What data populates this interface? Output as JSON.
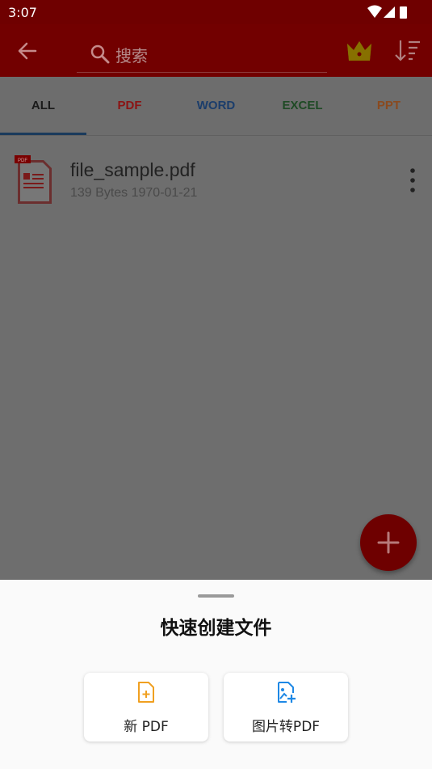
{
  "status_bar": {
    "time": "3:07"
  },
  "app_bar": {
    "search_placeholder": "搜索"
  },
  "tabs": [
    {
      "label": "ALL",
      "color": "#1a1a1a",
      "active": true
    },
    {
      "label": "PDF",
      "color": "#8b1414"
    },
    {
      "label": "WORD",
      "color": "#1b3d6b"
    },
    {
      "label": "EXCEL",
      "color": "#1f4a25"
    },
    {
      "label": "PPT",
      "color": "#8a4a1f"
    }
  ],
  "files": [
    {
      "name": "file_sample.pdf",
      "meta": "139 Bytes 1970-01-21",
      "icon": "pdf-file-icon",
      "icon_badge": "PDF"
    }
  ],
  "sheet": {
    "title": "快速创建文件",
    "actions": [
      {
        "label": "新 PDF",
        "icon": "new-pdf-icon",
        "color": "#f0a020"
      },
      {
        "label": "图片转PDF",
        "icon": "image-to-pdf-icon",
        "color": "#1e88e5"
      }
    ]
  },
  "colors": {
    "brand": "#c00000",
    "crown": "#f2c200"
  }
}
